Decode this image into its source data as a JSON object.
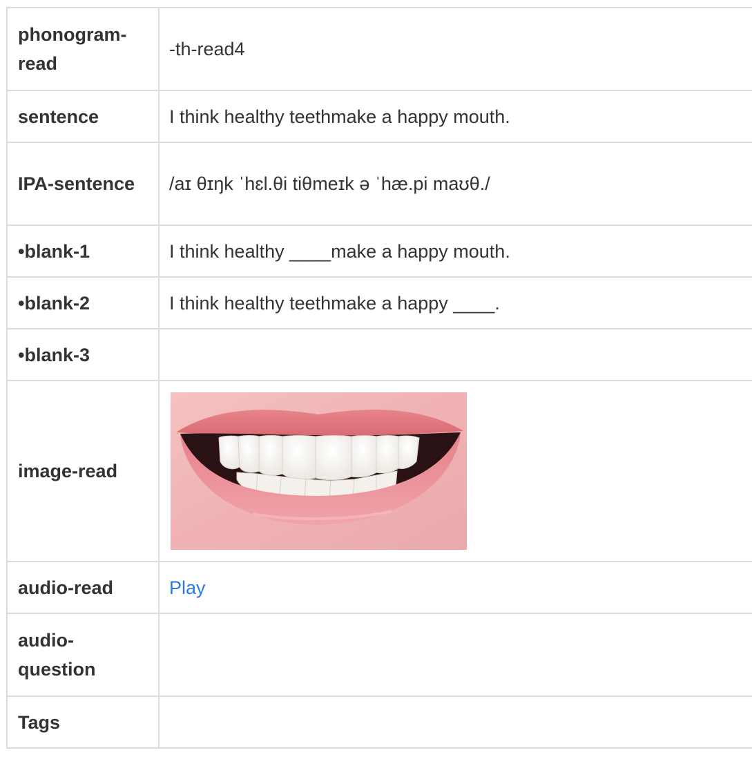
{
  "rows": [
    {
      "label": "phonogram-read",
      "value": "-th-read4"
    },
    {
      "label": "sentence",
      "value": "I think healthy teethmake a happy mouth."
    },
    {
      "label": "IPA-sentence",
      "value": "/aɪ θɪŋk ˈhɛl.θi tiθmeɪk ə ˈhæ.pi maʊθ./"
    },
    {
      "label": "•blank-1",
      "value": "I think healthy ____make a happy mouth."
    },
    {
      "label": "•blank-2",
      "value": "I think healthy teethmake a happy ____."
    },
    {
      "label": "•blank-3",
      "value": ""
    },
    {
      "label": "image-read",
      "value": "",
      "image": "smiling-mouth-with-white-teeth"
    },
    {
      "label": "audio-read",
      "value": "Play"
    },
    {
      "label": "audio-question",
      "value": ""
    },
    {
      "label": "Tags",
      "value": ""
    }
  ],
  "colors": {
    "border": "#dcdcdc",
    "text": "#333333",
    "link": "#2a7ae2"
  }
}
